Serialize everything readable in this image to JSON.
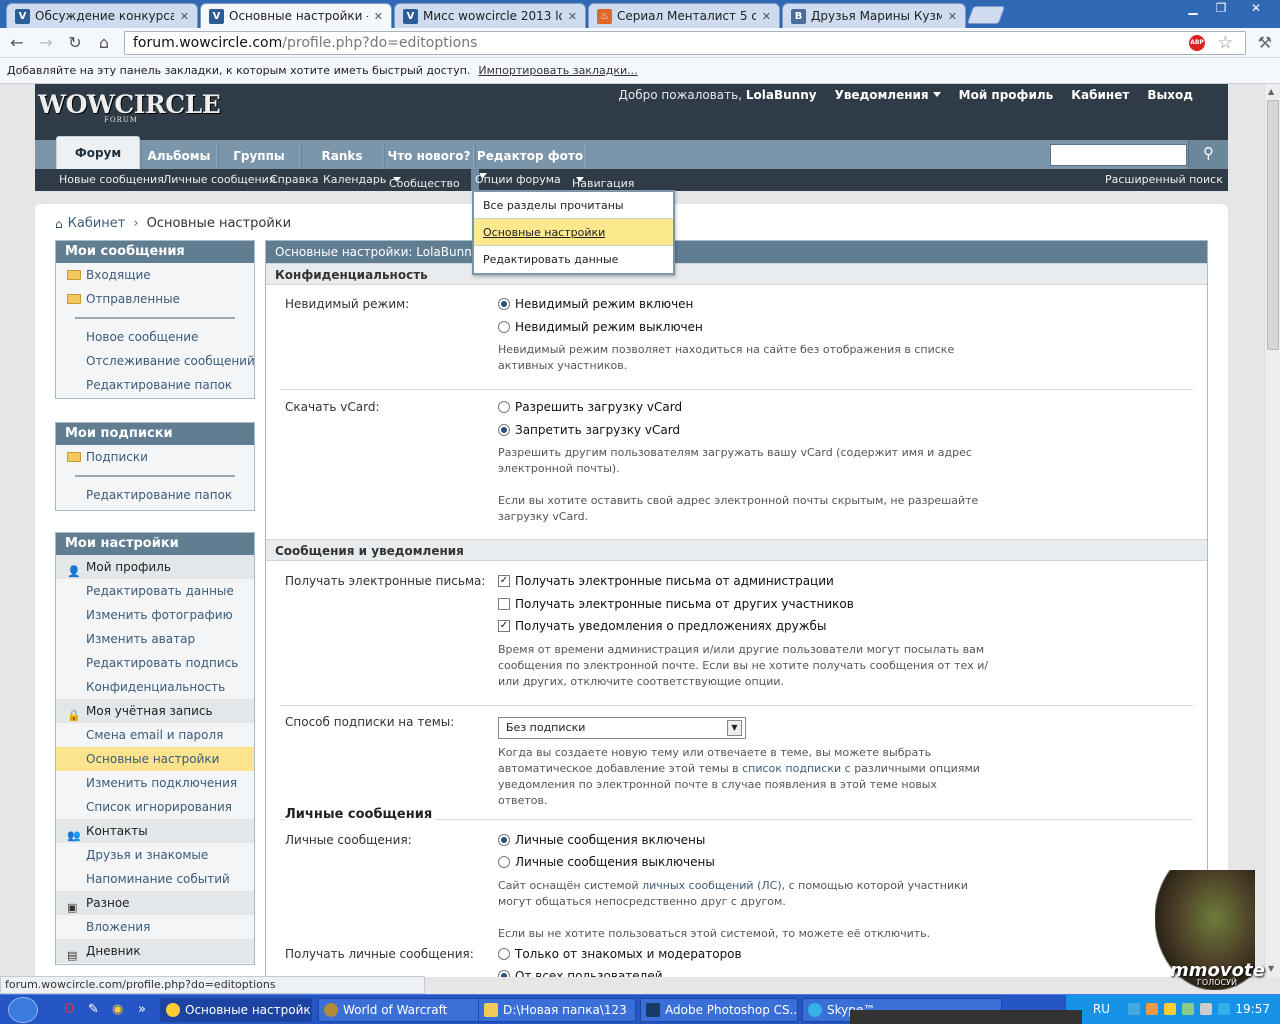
{
  "browser": {
    "tabs": [
      {
        "label": "Обсуждение конкурса (фл",
        "active": false,
        "icon": "vbulletin-favicon"
      },
      {
        "label": "Основные настройки - Фор",
        "active": true,
        "icon": "vbulletin-favicon"
      },
      {
        "label": "Мисс wowcircle 2013 logon3",
        "active": false,
        "icon": "vbulletin-favicon"
      },
      {
        "label": "Сериал Менталист 5 сезон",
        "active": false,
        "icon": "flame-favicon"
      },
      {
        "label": "Друзья Марины Кузмичево",
        "active": false,
        "icon": "vk-favicon"
      }
    ],
    "url_host": "forum.wowcircle.com",
    "url_path": "/profile.php?do=editoptions",
    "bookmarks_prompt": "Добавляйте на эту панель закладки, к которым хотите иметь быстрый доступ.",
    "bookmarks_import": "Импортировать закладки...",
    "status_url": "forum.wowcircle.com/profile.php?do=editoptions"
  },
  "forum": {
    "logo": "WOWCIRCLE",
    "logo_sub": "FORUM",
    "welcome": "Добро пожаловать,",
    "username": "LolaBunny",
    "top_links": {
      "notifications": "Уведомления",
      "my_profile": "Мой профиль",
      "cabinet": "Кабинет",
      "logout": "Выход"
    },
    "tabs": [
      "Форум",
      "Альбомы",
      "Группы",
      "Ranks",
      "Что нового?",
      "Редактор фото"
    ],
    "subnav": {
      "new_posts": "Новые сообщения",
      "private_messages": "Личные сообщения",
      "help": "Справка",
      "calendar": "Календарь",
      "community": "Сообщество",
      "forum_options": "Опции форума",
      "navigation": "Навигация",
      "advanced_search": "Расширенный поиск"
    },
    "dropdown": [
      "Все разделы прочитаны",
      "Основные настройки",
      "Редактировать данные"
    ],
    "breadcrumb": {
      "parent": "Кабинет",
      "current": "Основные настройки"
    }
  },
  "sidebar": {
    "messages": {
      "title": "Мои сообщения",
      "inbox": "Входящие",
      "sent": "Отправленные",
      "new_message": "Новое сообщение",
      "tracking": "Отслеживание сообщений",
      "edit_folders": "Редактирование папок"
    },
    "subscriptions": {
      "title": "Мои подписки",
      "subs": "Подписки",
      "edit_folders": "Редактирование папок"
    },
    "settings": {
      "title": "Мои настройки",
      "profile_group": "Мой профиль",
      "edit_data": "Редактировать данные",
      "change_photo": "Изменить фотографию",
      "change_avatar": "Изменить аватар",
      "edit_signature": "Редактировать подпись",
      "privacy": "Конфиденциальность",
      "account_group": "Моя учётная запись",
      "change_email": "Смена email и пароля",
      "basic_settings": "Основные настройки",
      "change_connections": "Изменить подключения",
      "ignore_list": "Список игнорирования",
      "contacts_group": "Контакты",
      "friends": "Друзья и знакомые",
      "event_reminders": "Напоминание событий",
      "misc_group": "Разное",
      "attachments": "Вложения",
      "diary": "Дневник"
    }
  },
  "main": {
    "title": "Основные настройки: LolaBunny",
    "privacy_section": "Конфиденциальность",
    "invisible_label": "Невидимый режим:",
    "invisible_on": "Невидимый режим включен",
    "invisible_off": "Невидимый режим выключен",
    "invisible_desc": "Невидимый режим позволяет находиться на сайте без отображения в списке активных участников.",
    "vcard_label": "Скачать vCard:",
    "vcard_allow": "Разрешить загрузку vCard",
    "vcard_deny": "Запретить загрузку vCard",
    "vcard_desc1": "Разрешить другим пользователям загружать вашу vCard (содержит имя и адрес электронной почты).",
    "vcard_desc2": "Если вы хотите оставить свой адрес электронной почты скрытым, не разрешайте загрузку vCard.",
    "messages_section": "Сообщения и уведомления",
    "email_label": "Получать электронные письма:",
    "email_admin": "Получать электронные письма от администрации",
    "email_members": "Получать электронные письма от других участников",
    "email_friend": "Получать уведомления о предложениях дружбы",
    "email_desc": "Время от времени администрация и/или другие пользователи могут посылать вам сообщения по электронной почте. Если вы не хотите получать сообщения от тех и/или других, отключите соответствующие опции.",
    "subscribe_label": "Способ подписки на темы:",
    "subscribe_value": "Без подписки",
    "subscribe_desc_a": "Когда вы создаете новую тему или отвечаете в теме, вы можете выбрать автоматическое добавление этой темы в ",
    "subscribe_desc_link": "список подписки",
    "subscribe_desc_b": " с различными опциями уведомления по электронной почте в случае появления в этой теме новых ответов.",
    "pm_subsection": "Личные сообщения",
    "pm_label": "Личные сообщения:",
    "pm_on": "Личные сообщения включены",
    "pm_off": "Личные сообщения выключены",
    "pm_desc_a": "Сайт оснащён системой ",
    "pm_desc_link": "личных сообщений (ЛС)",
    "pm_desc_b": ", с помощью которой участники могут общаться непосредственно друг с другом.",
    "pm_desc2": "Если вы не хотите пользоваться этой системой, то можете её отключить.",
    "pm_receive_label": "Получать личные сообщения:",
    "pm_from_friends": "Только от знакомых и модераторов",
    "pm_from_all": "От всех пользователей"
  },
  "ad": {
    "brand": "mmovote",
    "sub": "ГОЛОСУЙ"
  },
  "taskbar": {
    "items": [
      {
        "label": "Основные настройк...",
        "active": true,
        "icon": "chrome-icon"
      },
      {
        "label": "World of Warcraft",
        "active": false,
        "icon": "wow-icon"
      },
      {
        "label": "D:\\Новая папка\\123",
        "active": false,
        "icon": "folder-icon"
      },
      {
        "label": "Adobe Photoshop CS...",
        "active": false,
        "icon": "photoshop-icon"
      },
      {
        "label": "Skype™",
        "active": false,
        "icon": "skype-icon"
      }
    ],
    "lang": "RU",
    "clock": "19:57"
  },
  "colors": {
    "header": "#2f3c47",
    "nav": "#7b96aa",
    "panel_head": "#607d92",
    "highlight": "#fbe48d",
    "link": "#3d5b7a"
  }
}
